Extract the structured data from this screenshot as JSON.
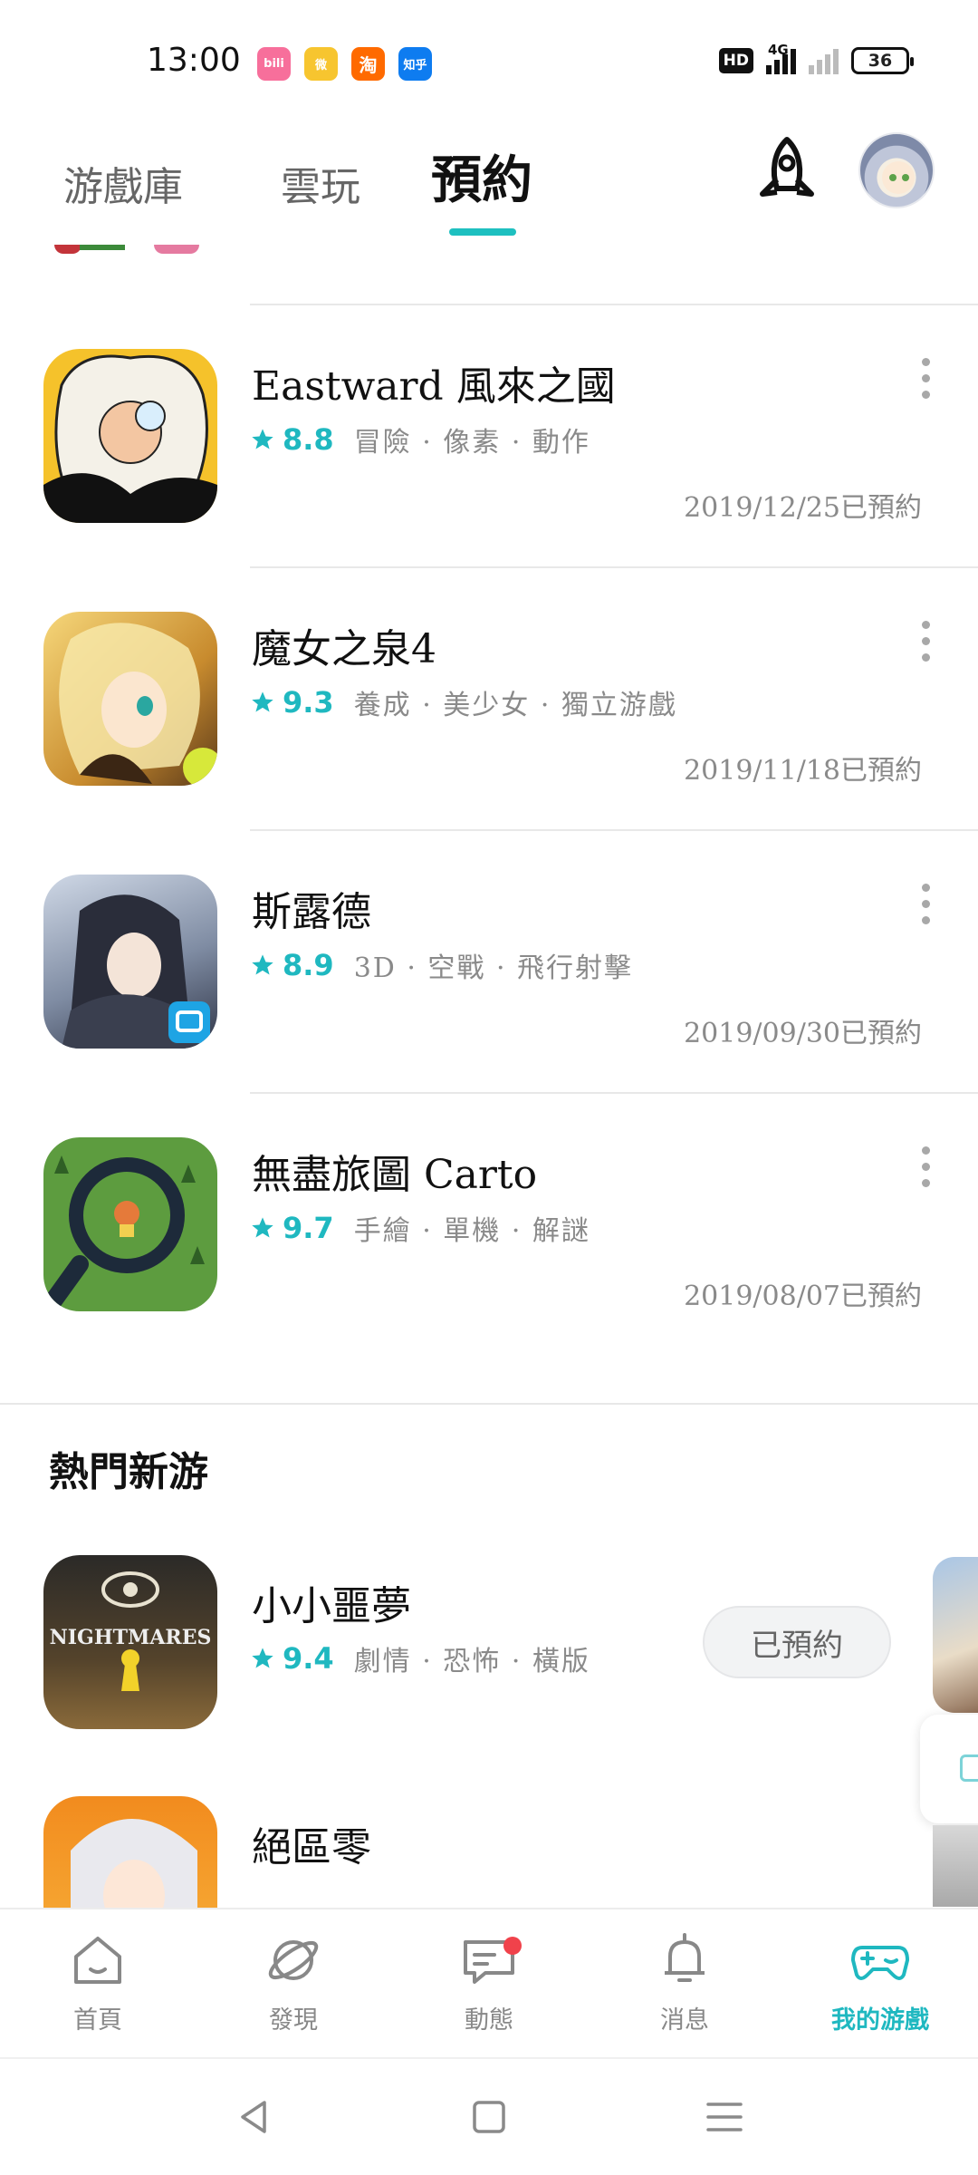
{
  "status_bar": {
    "time": "13:00",
    "apps": [
      {
        "name": "bilibili",
        "label": "bili",
        "color": "#f76f9b"
      },
      {
        "name": "weibo",
        "label": "微",
        "color": "#f7c52f"
      },
      {
        "name": "taobao",
        "label": "淘",
        "color": "#ff6a00"
      },
      {
        "name": "zhihu",
        "label": "知乎",
        "color": "#0e7cf0"
      }
    ],
    "network": "HD",
    "signal": "4G",
    "battery": "36"
  },
  "header": {
    "tabs": [
      {
        "label": "游戲庫"
      },
      {
        "label": "雲玩"
      },
      {
        "label": "預約",
        "active": true
      }
    ],
    "accent": "#1ec0c0"
  },
  "reservations": [
    {
      "title": "Eastward 風來之國",
      "score": "8.8",
      "tags": "冒險 · 像素 · 動作",
      "date": "2019/12/25已預約"
    },
    {
      "title": "魔女之泉4",
      "score": "9.3",
      "tags": "養成 · 美少女 · 獨立游戲",
      "date": "2019/11/18已預約"
    },
    {
      "title": "斯露德",
      "score": "8.9",
      "tags": "3D · 空戰 · 飛行射擊",
      "date": "2019/09/30已預約"
    },
    {
      "title": "無盡旅圖 Carto",
      "score": "9.7",
      "tags": "手繪 · 單機 · 解謎",
      "date": "2019/08/07已預約"
    }
  ],
  "hot_section": {
    "title": "熱門新游",
    "items": [
      {
        "title": "小小噩夢",
        "score": "9.4",
        "tags": "劇情 · 恐怖 · 橫版",
        "button": "已預約",
        "cover_text": "NIGHTMARES"
      },
      {
        "title": "絕區零"
      }
    ]
  },
  "bottom_nav": [
    {
      "label": "首頁",
      "icon": "home-icon"
    },
    {
      "label": "發現",
      "icon": "planet-icon"
    },
    {
      "label": "動態",
      "icon": "chat-icon",
      "badge": true
    },
    {
      "label": "消息",
      "icon": "bell-icon"
    },
    {
      "label": "我的游戲",
      "icon": "gamepad-icon",
      "active": true
    }
  ]
}
